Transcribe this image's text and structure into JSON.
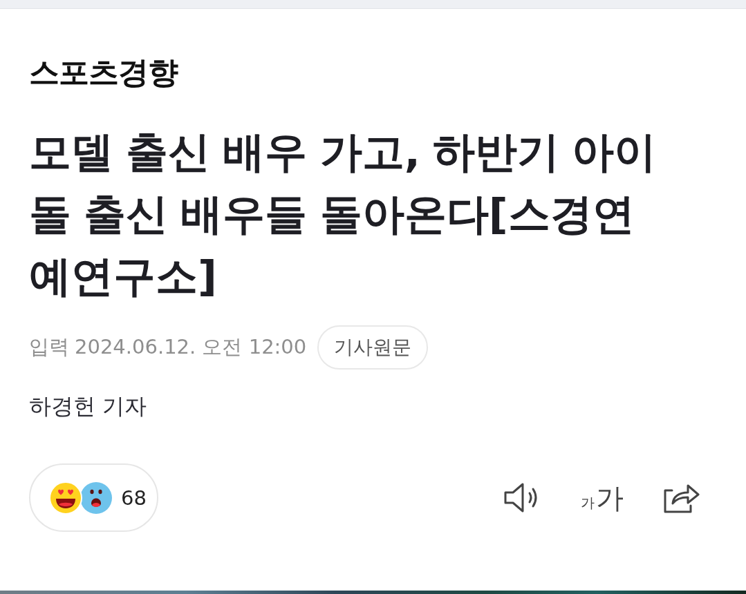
{
  "logo": {
    "text": "스포츠경향"
  },
  "headline": {
    "lines": [
      "모델 출신 배우 가고, 하반기 아이",
      "돌 출신 배우들 돌아온다[스경연",
      "예연구소]"
    ]
  },
  "meta": {
    "label": "입력",
    "datetime": "2024.06.12. 오전 12:00",
    "original_button": "기사원문"
  },
  "byline": "하경헌 기자",
  "reactions": {
    "emojis": [
      {
        "kind": "love"
      },
      {
        "kind": "surprise"
      }
    ],
    "count": "68"
  },
  "tools": [
    {
      "kind": "listen"
    },
    {
      "kind": "font_size",
      "small": "가",
      "large": "가"
    },
    {
      "kind": "share"
    }
  ]
}
